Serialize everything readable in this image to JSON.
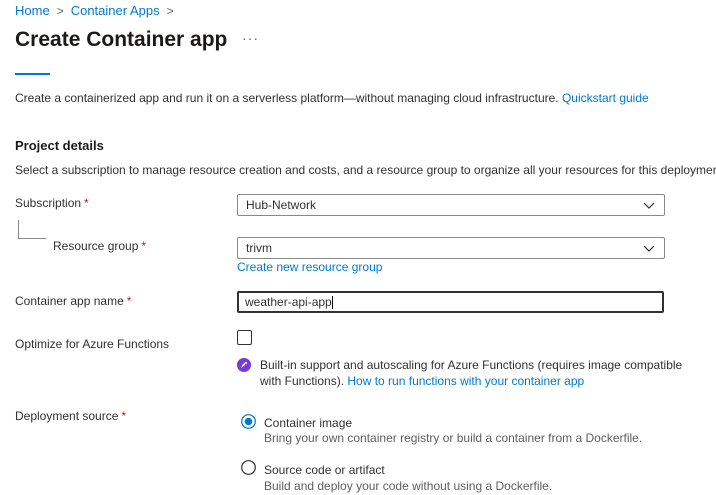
{
  "breadcrumb": {
    "home": "Home",
    "container_apps": "Container Apps",
    "separator": ">"
  },
  "page": {
    "title": "Create Container app",
    "more": "···"
  },
  "intro": {
    "text": "Create a containerized app and run it on a serverless platform—without managing cloud infrastructure.",
    "link": "Quickstart guide"
  },
  "project": {
    "heading": "Project details",
    "description": "Select a subscription to manage resource creation and costs, and a resource group to organize all your resources for this deployment."
  },
  "form": {
    "required_mark": "*",
    "subscription": {
      "label": "Subscription",
      "value": "Hub-Network"
    },
    "resource_group": {
      "label": "Resource group",
      "value": "trivm",
      "create_link": "Create new resource group"
    },
    "app_name": {
      "label": "Container app name",
      "value": "weather-api-app"
    },
    "optimize": {
      "label": "Optimize for Azure Functions",
      "checked": false,
      "info_text": "Built-in support and autoscaling for Azure Functions (requires image compatible with Functions).",
      "info_link": "How to run functions with your container app"
    },
    "deployment": {
      "label": "Deployment source",
      "options": [
        {
          "title": "Container image",
          "subtitle": "Bring your own container registry or build a container from a Dockerfile.",
          "selected": true
        },
        {
          "title": "Source code or artifact",
          "subtitle": "Build and deploy your code without using a Dockerfile.",
          "selected": false
        }
      ]
    }
  },
  "colors": {
    "accent": "#0078d4",
    "required": "#a4262c",
    "functions_badge": "#773adc"
  }
}
